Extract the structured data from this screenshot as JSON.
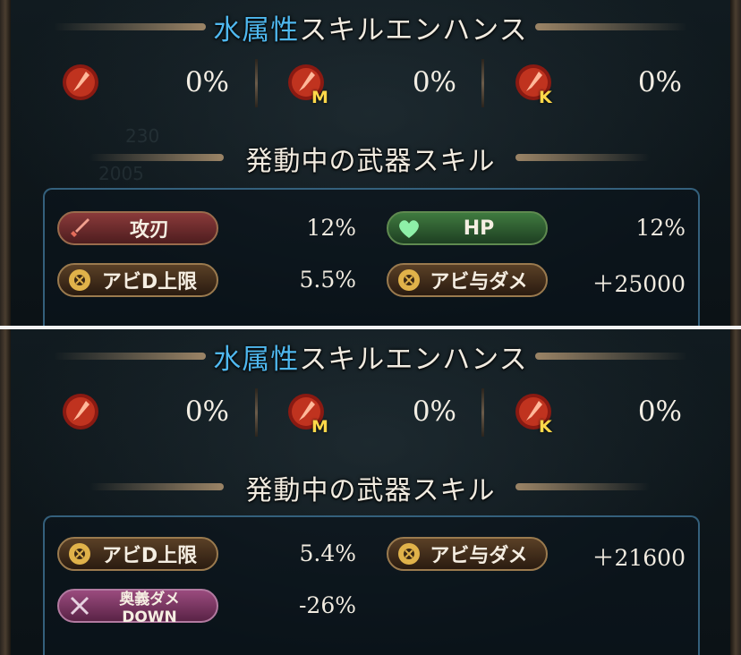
{
  "panels": [
    {
      "title_blue": "水属性",
      "title_rest": "スキルエンハンス",
      "enhance": [
        {
          "icon": "water-blade-icon",
          "badge": "",
          "value": "0%"
        },
        {
          "icon": "water-blade-magna-icon",
          "badge": "M",
          "value": "0%"
        },
        {
          "icon": "water-blade-ex-icon",
          "badge": "K",
          "value": "0%"
        }
      ],
      "skills_title": "発動中の武器スキル",
      "skills": [
        {
          "label": "攻刃",
          "value": "12%",
          "style": "red",
          "icon": "sword-icon"
        },
        {
          "label": "HP",
          "value": "12%",
          "style": "green",
          "icon": "heart-icon"
        },
        {
          "label": "アビD上限",
          "value": "5.5%",
          "style": "brown",
          "icon": "gear-icon"
        },
        {
          "label": "アビ与ダメ",
          "value": "＋25000",
          "style": "brown",
          "icon": "gear-icon"
        }
      ]
    },
    {
      "title_blue": "水属性",
      "title_rest": "スキルエンハンス",
      "enhance": [
        {
          "icon": "water-blade-icon",
          "badge": "",
          "value": "0%"
        },
        {
          "icon": "water-blade-magna-icon",
          "badge": "M",
          "value": "0%"
        },
        {
          "icon": "water-blade-ex-icon",
          "badge": "K",
          "value": "0%"
        }
      ],
      "skills_title": "発動中の武器スキル",
      "skills": [
        {
          "label": "アビD上限",
          "value": "5.4%",
          "style": "brown",
          "icon": "gear-icon"
        },
        {
          "label": "アビ与ダメ",
          "value": "＋21600",
          "style": "brown",
          "icon": "gear-icon"
        },
        {
          "label": "奥義ダメDOWN",
          "value": "-26%",
          "style": "pink",
          "icon": "crossed-swords-icon"
        }
      ]
    }
  ]
}
